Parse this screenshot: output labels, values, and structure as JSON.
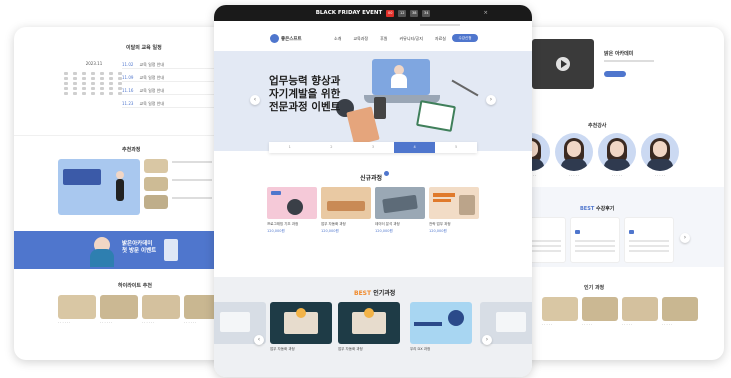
{
  "topbar": {
    "event_label": "BLACK FRIDAY EVENT",
    "countdown": [
      "00",
      "12",
      "38",
      "34"
    ],
    "close": "×"
  },
  "nav": {
    "logo_text": "좋은스프트",
    "menu": [
      "소개",
      "교육과정",
      "후원",
      "커뮤니티/공지",
      "자료실"
    ],
    "cta": "수강신청"
  },
  "hero": {
    "title": "업무능력 향상과\n자기계발을 위한\n전문과정 이벤트",
    "tabs": [
      "1",
      "2",
      "3",
      "4",
      "5"
    ],
    "active_tab": 3
  },
  "new_courses": {
    "title": "신규과정",
    "items": [
      {
        "title": "프로그래밍 기초 과정",
        "price": "120,000원"
      },
      {
        "title": "업무 자동화 과정",
        "price": "120,000원"
      },
      {
        "title": "데이터 분석 과정",
        "price": "120,000원"
      },
      {
        "title": "전략 업무 과정",
        "price": "120,000원"
      }
    ]
  },
  "popular": {
    "best_label": "BEST",
    "title": "인기과정",
    "items": [
      {
        "title": "업무 자동화 과정"
      },
      {
        "title": "업무 자동화 과정"
      },
      {
        "title": "업무 자동화 과정"
      },
      {
        "title": "우리 DX 과정"
      }
    ]
  },
  "left_page": {
    "schedule_title": "이달의 교육 일정",
    "schedule": [
      {
        "date": "11.02",
        "name": "교육 일정 안내"
      },
      {
        "date": "11.09",
        "name": "교육 일정 안내"
      },
      {
        "date": "11.16",
        "name": "교육 일정 안내"
      },
      {
        "date": "11.23",
        "name": "교육 일정 안내"
      }
    ],
    "recommend_title": "추천과정",
    "banner_text": "밝은아카데미\n첫 방문 이벤트",
    "bottom_title": "하이라이트 추천"
  },
  "right_page": {
    "video_title": "밝은 아카데미",
    "teachers_title": "추천강사",
    "reviews_best": "BEST",
    "reviews_title": "수강후기",
    "bottom_title": "인기 과정"
  },
  "colors": {
    "brand_blue": "#4f76cd",
    "hero_bg": "#e3e9f4",
    "topbar": "#1a1a1a",
    "countdown_red": "#e0302a"
  }
}
